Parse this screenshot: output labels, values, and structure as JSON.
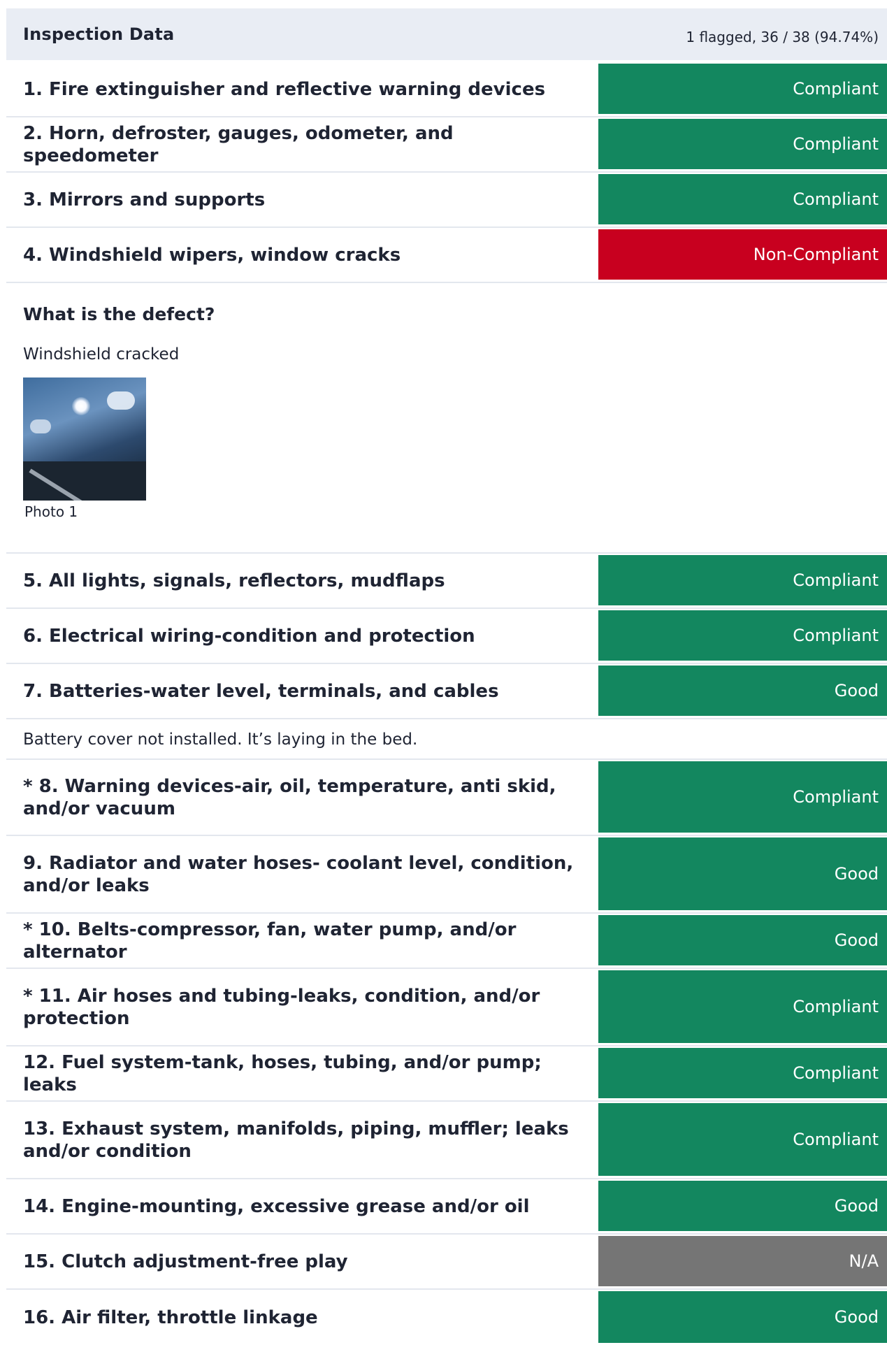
{
  "header": {
    "title": "Inspection Data",
    "summary": "1 flagged, 36 / 38 (94.74%)"
  },
  "items": [
    {
      "label": "1. Fire extinguisher and reflective warning devices",
      "status": "Compliant"
    },
    {
      "label": "2. Horn, defroster, gauges, odometer, and speedometer",
      "status": "Compliant"
    },
    {
      "label": "3. Mirrors and supports",
      "status": "Compliant"
    },
    {
      "label": "4. Windshield wipers, window cracks",
      "status": "Non-Compliant"
    },
    {
      "label": "5. All lights, signals, reflectors, mudflaps",
      "status": "Compliant"
    },
    {
      "label": "6. Electrical wiring-condition and protection",
      "status": "Compliant"
    },
    {
      "label": "7. Batteries-water level, terminals, and cables",
      "status": "Good"
    },
    {
      "label": "* 8. Warning devices-air, oil, temperature, anti skid, and/or vacuum",
      "status": "Compliant"
    },
    {
      "label": "9. Radiator and water hoses- coolant level, condition, and/or leaks",
      "status": "Good"
    },
    {
      "label": "* 10. Belts-compressor, fan, water pump, and/or alternator",
      "status": "Good"
    },
    {
      "label": "* 11. Air hoses and tubing-leaks, condition, and/or protection",
      "status": "Compliant"
    },
    {
      "label": "12. Fuel system-tank, hoses, tubing, and/or pump; leaks",
      "status": "Compliant"
    },
    {
      "label": "13. Exhaust system, manifolds, piping, muffler; leaks and/or condition",
      "status": "Compliant"
    },
    {
      "label": "14. Engine-mounting, excessive grease and/or oil",
      "status": "Good"
    },
    {
      "label": "15. Clutch adjustment-free play",
      "status": "N/A"
    },
    {
      "label": "16. Air filter, throttle linkage",
      "status": "Good"
    }
  ],
  "defect": {
    "question": "What is the defect?",
    "answer": "Windshield cracked",
    "photo_caption": "Photo 1"
  },
  "battery_note": "Battery cover not installed. It’s laying in the bed.",
  "colors": {
    "compliant": "#13875f",
    "non_compliant": "#c8001f",
    "na": "#757575",
    "header_bg": "#e9edf4"
  }
}
